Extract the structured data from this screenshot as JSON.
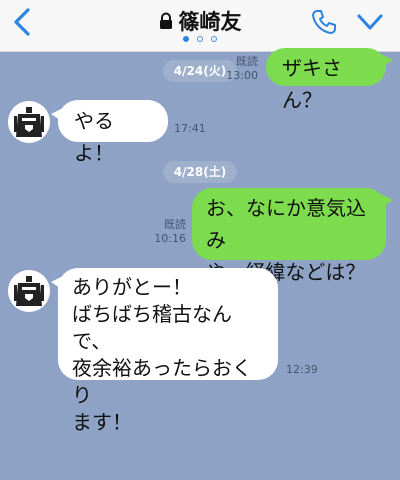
{
  "header": {
    "contact_name": "篠崎友",
    "back_icon": "chevron-left-icon",
    "lock_icon": "lock-icon",
    "phone_icon": "phone-icon",
    "menu_icon": "chevron-down-icon",
    "accent": "#2d83e0"
  },
  "colors": {
    "chat_background": "#8da2c4",
    "sent_bubble": "#7ddc4e",
    "received_bubble": "#ffffff"
  },
  "messages": [
    {
      "side": "sent",
      "date": "4/24(火)",
      "read": "既読",
      "time": "13:00",
      "text": "ザキさん？"
    },
    {
      "side": "received",
      "time": "17:41",
      "text": "やるよ！"
    },
    {
      "side": "sent",
      "date": "4/28(土)",
      "read": "既読",
      "time": "10:16",
      "lines": [
        "お、なにか意気込み",
        "や、経緯などは？"
      ]
    },
    {
      "side": "received",
      "time": "12:39",
      "lines": [
        "ありがとー！",
        "ばちばち稽古なんで、",
        "夜余裕あったらおくり",
        "ます！"
      ]
    }
  ]
}
